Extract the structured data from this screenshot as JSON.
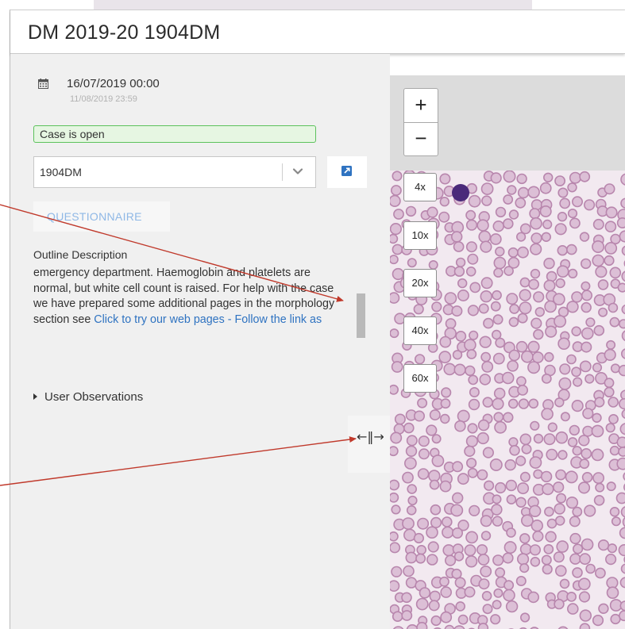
{
  "header": {
    "title": "DM 2019-20 1904DM"
  },
  "dates": {
    "start": "16/07/2019 00:00",
    "end": "11/08/2019 23:59"
  },
  "status": {
    "label": "Case is open"
  },
  "case_select": {
    "value": "1904DM"
  },
  "questionnaire": {
    "label": "QUESTIONNAIRE"
  },
  "outline": {
    "heading": "Outline Description",
    "text": "emergency department. Haemoglobin and platelets are normal, but white cell count is raised. For help with the case we have prepared some additional pages in the morphology section see ",
    "link": "Click to try our web pages - Follow the link as"
  },
  "user_observations": {
    "label": "User Observations"
  },
  "splitter": {
    "glyph": "←‖→"
  },
  "viewer": {
    "zoom_in": "+",
    "zoom_out": "−",
    "magnifications": [
      "4x",
      "10x",
      "20x",
      "40x",
      "60x"
    ]
  },
  "colors": {
    "status_border": "#5cc25c",
    "status_bg": "#e6f6e2",
    "link": "#2f73c1",
    "arrow": "#c0392b",
    "questionnaire": "#8fb8e6"
  },
  "icons": {
    "calendar": "calendar-icon",
    "chevron": "chevron-down-icon",
    "external": "external-link-icon",
    "expand": "expand-triangle-icon"
  }
}
